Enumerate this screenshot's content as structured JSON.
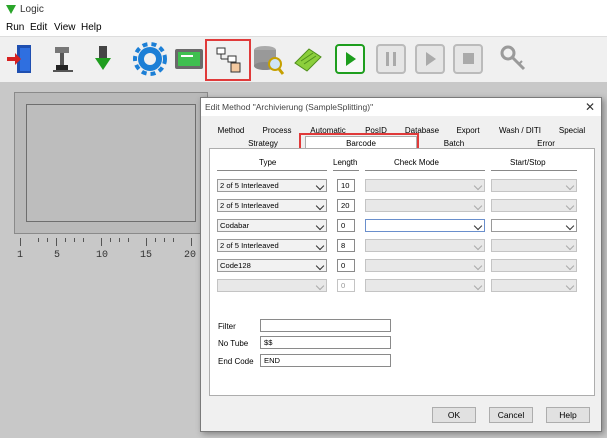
{
  "app": {
    "title": "Logic"
  },
  "menu": [
    "Run",
    "Edit",
    "View",
    "Help"
  ],
  "toolbar_icons": [
    "exit-door-icon",
    "robot-arm-icon",
    "download-arrow-icon",
    "settings-gear-icon",
    "monitor-icon",
    "method-network-icon",
    "database-search-icon",
    "reagent-tray-icon",
    "run-play-icon",
    "pause-icon",
    "step-icon",
    "stop-icon",
    "key-icon"
  ],
  "ruler": {
    "labels": [
      "1",
      "5",
      "10",
      "15",
      "20"
    ]
  },
  "dialog": {
    "title": "Edit Method \"Archivierung (SampleSplitting)\"",
    "tabs_row1": [
      "Method",
      "Process",
      "Automatic",
      "PosID",
      "Database",
      "Export",
      "Wash / DITI",
      "Special"
    ],
    "tabs_row2": [
      "Strategy",
      "Barcode",
      "Batch",
      "Error"
    ],
    "active_tab": "Barcode",
    "columns": {
      "type": "Type",
      "length": "Length",
      "check_mode": "Check Mode",
      "start_stop": "Start/Stop"
    },
    "rows": [
      {
        "type": "2 of 5 Interleaved",
        "length": "10"
      },
      {
        "type": "2 of 5 Interleaved",
        "length": "20"
      },
      {
        "type": "Codabar",
        "length": "0"
      },
      {
        "type": "2 of 5 Interleaved",
        "length": "8"
      },
      {
        "type": "Code128",
        "length": "0"
      },
      {
        "type": "",
        "length": "0"
      }
    ],
    "fields": {
      "filter_label": "Filter",
      "filter_value": "",
      "no_tube_label": "No Tube",
      "no_tube_value": "$$",
      "end_code_label": "End Code",
      "end_code_value": "END"
    },
    "buttons": {
      "ok": "OK",
      "cancel": "Cancel",
      "help": "Help"
    }
  },
  "colors": {
    "highlight_box": "#e03a3a",
    "play_green": "#1e9e1e",
    "gear_blue": "#1c7fd6"
  }
}
